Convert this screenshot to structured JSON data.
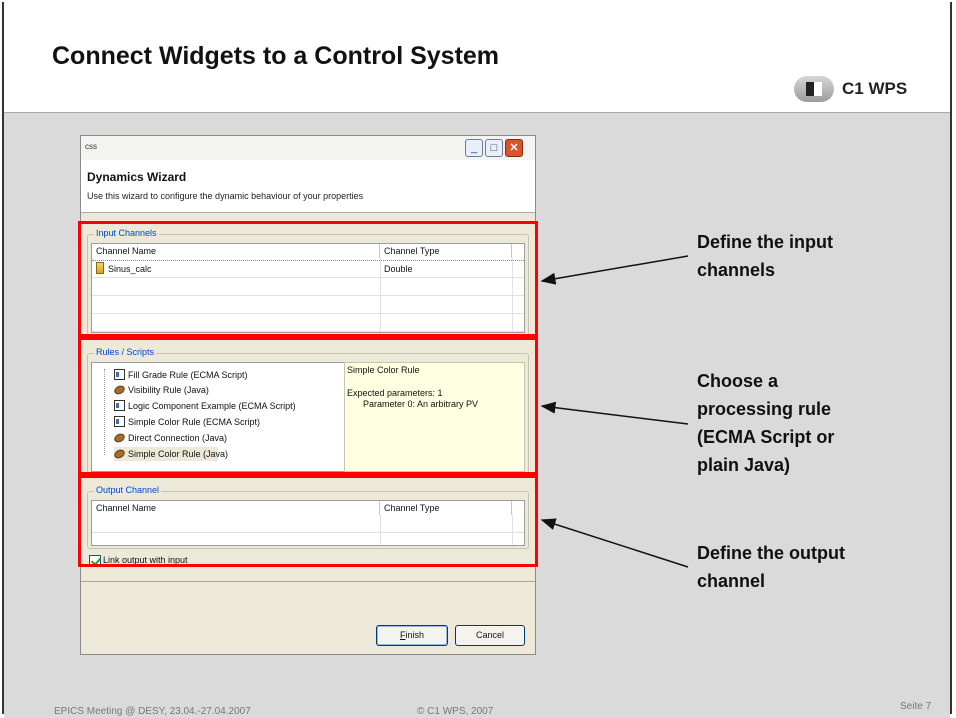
{
  "slide": {
    "title": "Connect Widgets to a Control System",
    "logo_text": "C1 WPS",
    "footer_left": "EPICS Meeting @ DESY, 23.04.-27.04.2007",
    "footer_center": "© C1 WPS, 2007",
    "footer_right": "Seite 7"
  },
  "window": {
    "title": "css",
    "buttons": {
      "minimize": "_",
      "maximize": "□",
      "close": "✕"
    },
    "header_title": "Dynamics Wizard",
    "header_desc": "Use this wizard to configure the dynamic behaviour of your properties"
  },
  "input_channels": {
    "label": "Input Channels",
    "columns": [
      "Channel Name",
      "Channel Type"
    ],
    "rows": [
      {
        "name": "Sinus_calc",
        "type": "Double"
      }
    ]
  },
  "rules": {
    "label": "Rules / Scripts",
    "items": [
      {
        "label": "Fill Grade Rule (ECMA Script)",
        "icon": "script-icon"
      },
      {
        "label": "Visibility Rule (Java)",
        "icon": "java-bean-icon"
      },
      {
        "label": "Logic Component Example (ECMA Script)",
        "icon": "script-icon"
      },
      {
        "label": "Simple Color Rule (ECMA Script)",
        "icon": "script-icon"
      },
      {
        "label": "Direct Connection (Java)",
        "icon": "java-bean-icon"
      },
      {
        "label": "Simple Color Rule (Java)",
        "icon": "java-bean-icon",
        "selected": true
      }
    ],
    "description": {
      "title": "Simple Color Rule",
      "line1": "Expected parameters: 1",
      "line2": "Parameter 0: An arbitrary PV"
    }
  },
  "output_channel": {
    "label": "Output Channel",
    "columns": [
      "Channel Name",
      "Channel Type"
    ]
  },
  "link_checkbox": {
    "label": "Link output with input",
    "checked": true
  },
  "finish_button": {
    "label_underlined": "F",
    "label_rest": "inish"
  },
  "cancel_button": {
    "label": "Cancel"
  },
  "callouts": {
    "input": [
      "Define the input",
      "channels"
    ],
    "rule": [
      "Choose a",
      "processing rule",
      "(ECMA Script or",
      "plain Java)"
    ],
    "output": [
      "Define the output",
      "channel"
    ]
  },
  "colors": {
    "highlight": "#ff0000",
    "dialog_bg": "#ece9d8",
    "description_bg": "#ffffe1"
  }
}
